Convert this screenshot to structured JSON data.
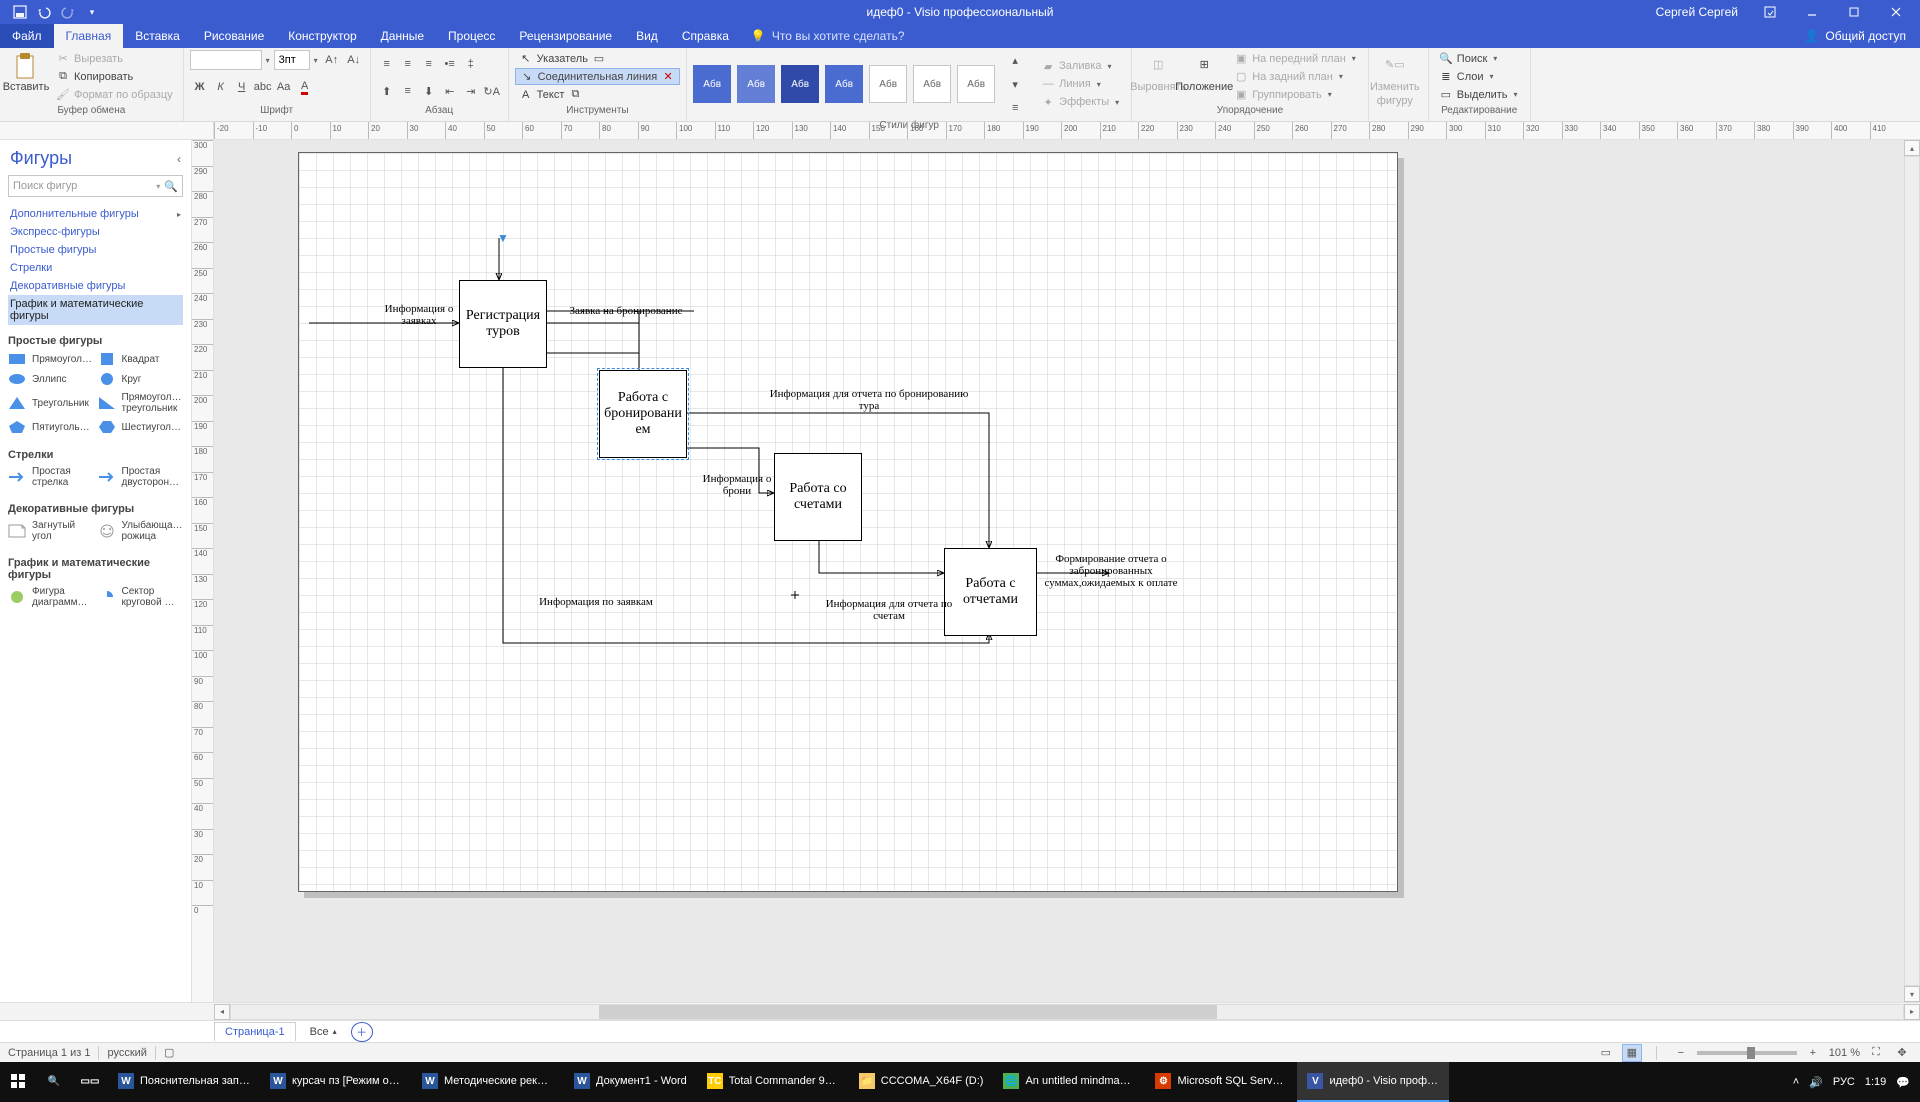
{
  "titlebar": {
    "doc": "идеф0  -  Visio профессиональный",
    "user": "Сергей Сергей"
  },
  "tabs": {
    "file": "Файл",
    "home": "Главная",
    "insert": "Вставка",
    "draw": "Рисование",
    "design": "Конструктор",
    "data": "Данные",
    "process": "Процесс",
    "review": "Рецензирование",
    "view": "Вид",
    "help": "Справка",
    "tellme": "Что вы хотите сделать?",
    "share": "Общий доступ"
  },
  "ribbon": {
    "clipboard": {
      "paste": "Вставить",
      "cut": "Вырезать",
      "copy": "Копировать",
      "formatpainter": "Формат по образцу",
      "label": "Буфер обмена"
    },
    "font": {
      "size": "3пт",
      "label": "Шрифт"
    },
    "paragraph": {
      "label": "Абзац"
    },
    "tools": {
      "pointer": "Указатель",
      "connector": "Соединительная линия",
      "text": "Текст",
      "label": "Инструменты"
    },
    "styles": {
      "label": "Стили фигур",
      "swatch": "Абв",
      "fill": "Заливка",
      "line": "Линия",
      "effects": "Эффекты"
    },
    "arrange": {
      "align": "Выровнять",
      "position": "Положение",
      "bringfront": "На передний план",
      "sendback": "На задний план",
      "group": "Группировать",
      "label": "Упорядочение"
    },
    "editshape": {
      "label1": "Изменить",
      "label2": "фигуру"
    },
    "editing": {
      "find": "Поиск",
      "layers": "Слои",
      "select": "Выделить",
      "label": "Редактирование"
    }
  },
  "shapes": {
    "title": "Фигуры",
    "search": "Поиск фигур",
    "more": "Дополнительные фигуры",
    "stencils": [
      "Экспресс-фигуры",
      "Простые фигуры",
      "Стрелки",
      "Декоративные фигуры",
      "График и математические фигуры"
    ],
    "sec_simple": "Простые фигуры",
    "simple": [
      {
        "n": "Прямоугол…",
        "t": "rect",
        "c": "#4a8fe8"
      },
      {
        "n": "Квадрат",
        "t": "square",
        "c": "#4a8fe8"
      },
      {
        "n": "Эллипс",
        "t": "ellipse",
        "c": "#4a8fe8"
      },
      {
        "n": "Круг",
        "t": "circle",
        "c": "#4a8fe8"
      },
      {
        "n": "Треугольник",
        "t": "tri",
        "c": "#4a8fe8"
      },
      {
        "n": "Прямоугол… треугольник",
        "t": "rtri",
        "c": "#4a8fe8"
      },
      {
        "n": "Пятиуголь…",
        "t": "penta",
        "c": "#4a8fe8"
      },
      {
        "n": "Шестиугол…",
        "t": "hexa",
        "c": "#4a8fe8"
      }
    ],
    "sec_arrows": "Стрелки",
    "arrows": [
      {
        "n": "Простая стрелка"
      },
      {
        "n": "Простая двусторон…"
      }
    ],
    "sec_deco": "Декоративные фигуры",
    "deco": [
      {
        "n": "Загнутый угол"
      },
      {
        "n": "Улыбающа… рожица"
      }
    ],
    "sec_math": "График и математические фигуры",
    "math": [
      {
        "n": "Фигура диаграмм…"
      },
      {
        "n": "Сектор круговой …"
      }
    ]
  },
  "diagram": {
    "nodes": {
      "n1": "Регистрация туров",
      "n2": "Работа с бронировани ем",
      "n3": "Работа со счетами",
      "n4": "Работа с отчетами"
    },
    "labels": {
      "l1": "Информация о заявках",
      "l2": "Заявка на бронирование",
      "l3": "Информация для отчета по бронированию тура",
      "l4": "Информация о брони",
      "l5": "Информация по заявкам",
      "l6": "Информация для отчета по счетам",
      "l7": "Формирование отчета о забронированных суммах,ожидаемых к оплате"
    }
  },
  "pagetabs": {
    "p1": "Страница-1",
    "all": "Все"
  },
  "status": {
    "pages": "Страница 1 из 1",
    "lang": "русский",
    "zoom": "101 %"
  },
  "taskbar": {
    "items": [
      "Пояснительная запи…",
      "курсач пз [Режим ог…",
      "Методические реко…",
      "Документ1 - Word",
      "Total Commander 9.0…",
      "CCCOMA_X64F (D:)",
      "An untitled mindmap…",
      "Microsoft SQL Server …",
      "идеф0 - Visio профес…"
    ],
    "lang": "РУС",
    "time": "1:19"
  }
}
